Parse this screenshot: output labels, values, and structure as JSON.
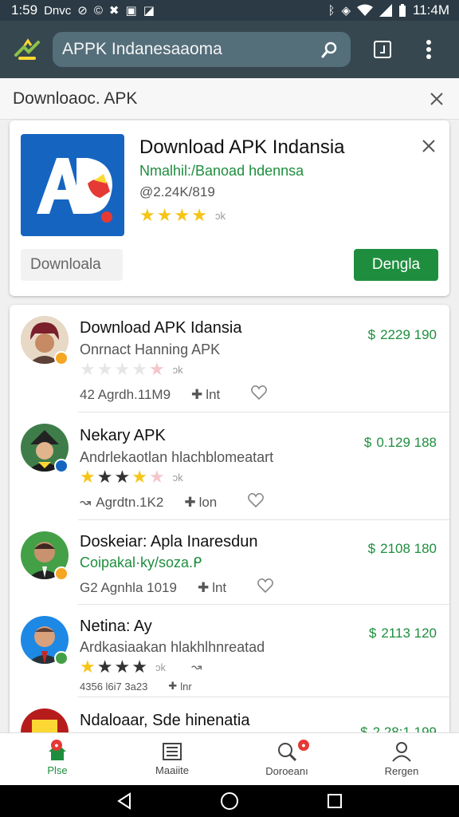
{
  "status_bar": {
    "time": "1:59",
    "carrier": "Dnvc",
    "right_time": "11:4M"
  },
  "search": {
    "value": "APPK Indanesaaoma"
  },
  "subheader": {
    "title": "Downloaoc. APK"
  },
  "featured": {
    "title": "Download APK Indansia",
    "subtitle": "Nmalhil:/Banoad hdennsa",
    "meta": "@2.24K/819",
    "rating": 4,
    "rating_note": "ɔk",
    "secondary_label": "Downloala",
    "primary_label": "Dengla",
    "icon_letters": "AD"
  },
  "list": [
    {
      "title": "Download APK Idansia",
      "subtitle": "Onrnact Hanning APK",
      "meta": "42 Agrdh.11M9",
      "pin": "lnt",
      "price": "2229 190",
      "stars": "off",
      "note": "ɔk"
    },
    {
      "title": "Nekary APK",
      "subtitle": "Andrlekaotlan hlachblomeatart",
      "meta": "Agrdtn.1K2",
      "pin": "lon",
      "price": "0.129 188",
      "stars": "mixed",
      "note": "ɔk"
    },
    {
      "title": "Doskeiar: Apla Inaresdun",
      "subtitle": "Coipakal·ky/soza.ᑭ",
      "meta": "G2 Agnhla 1019",
      "pin": "lnt",
      "price": "2108 180",
      "stars": "none",
      "note": ""
    },
    {
      "title": "Netina: Ay",
      "subtitle": "Ardkasiaakan hlakhlhnreatad",
      "meta": "4356 l6i7 3a23",
      "pin": "lnr",
      "price": "2113 120",
      "stars": "dark",
      "note": "ɔk"
    },
    {
      "title": "Ndaloaar, Sde hinenatia",
      "subtitle": "",
      "meta": "",
      "pin": "",
      "price": "2.28:1 199",
      "stars": "none",
      "note": ""
    }
  ],
  "bottom_nav": [
    {
      "label": "Plse",
      "badge": ""
    },
    {
      "label": "Maaiite",
      "badge": ""
    },
    {
      "label": "Doroeanı",
      "badge": ""
    },
    {
      "label": "Rergen",
      "badge": ""
    }
  ],
  "colors": {
    "accent": "#1e8e3e",
    "appbar": "#37474f",
    "status": "#2b3a44",
    "star": "#f5c518"
  }
}
